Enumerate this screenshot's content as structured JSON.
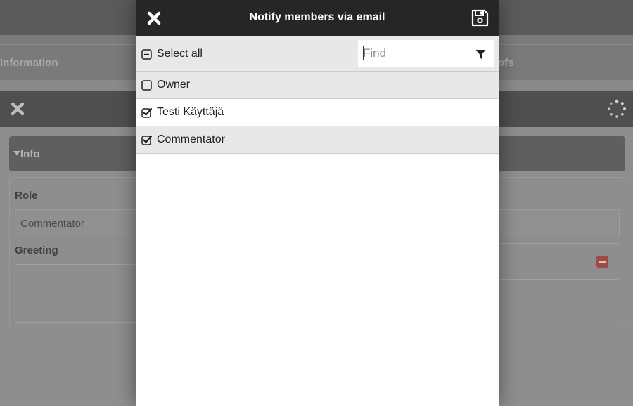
{
  "background": {
    "tab_left_label": "Information",
    "tab_right_label": "ofs",
    "section_label": "Info",
    "role_label": "Role",
    "role_value": "Commentator",
    "greeting_label": "Greeting",
    "icons": [
      "close-icon",
      "loading-spinner-icon",
      "caret-down-icon",
      "remove-icon"
    ]
  },
  "modal": {
    "title": "Notify members via email",
    "icons": {
      "close": "close-icon",
      "save": "floppy-disk-icon",
      "filter": "filter-funnel-icon"
    },
    "select_all": {
      "label": "Select all",
      "state": "indeterminate"
    },
    "find": {
      "placeholder": "Find",
      "value": ""
    },
    "members": [
      {
        "label": "Owner",
        "checked": false
      },
      {
        "label": "Testi Käyttäjä",
        "checked": true
      },
      {
        "label": "Commentator",
        "checked": true
      }
    ]
  },
  "colors": {
    "header_bg": "#262626",
    "row_alt_bg": "#e8e8e8",
    "overlay_tint": "#8a8a8a",
    "remove_button": "#9e4b45"
  }
}
